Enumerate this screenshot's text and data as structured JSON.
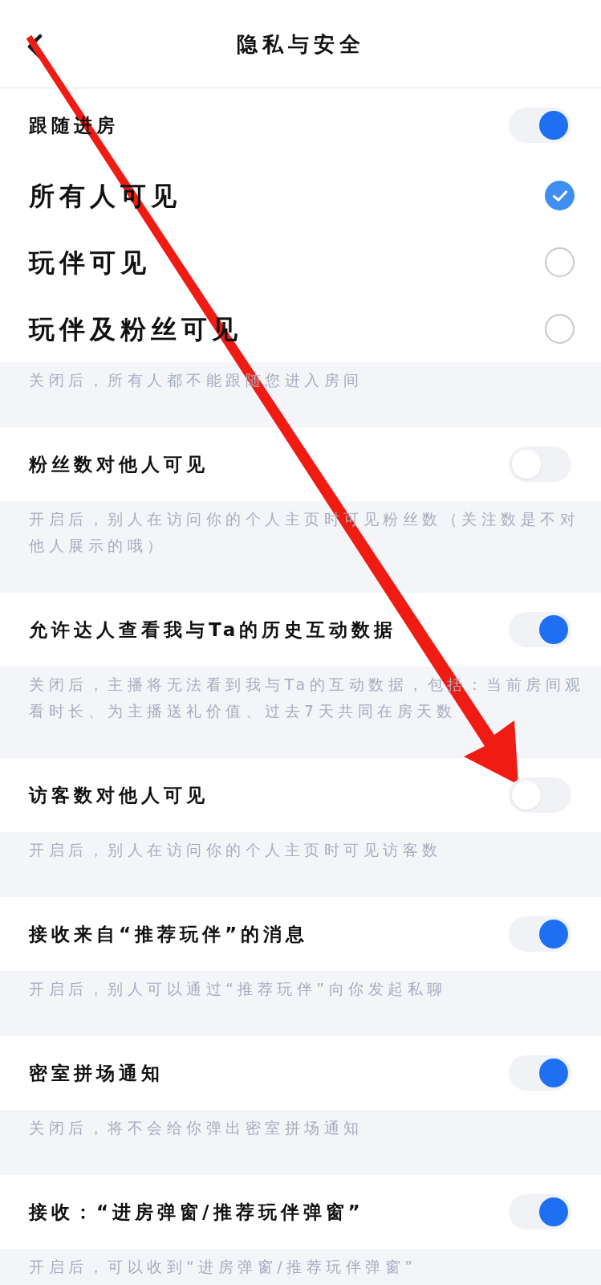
{
  "header": {
    "title": "隐私与安全"
  },
  "settings": [
    {
      "label": "跟随进房",
      "on": true,
      "options": [
        {
          "label": "所有人可见",
          "selected": true
        },
        {
          "label": "玩伴可见",
          "selected": false
        },
        {
          "label": "玩伴及粉丝可见",
          "selected": false
        }
      ],
      "description": "关闭后，所有人都不能跟随您进入房间"
    },
    {
      "label": "粉丝数对他人可见",
      "on": false,
      "description": "开启后，别人在访问你的个人主页时可见粉丝数（关注数是不对他人展示的哦）"
    },
    {
      "label": "允许达人查看我与Ta的历史互动数据",
      "on": true,
      "description": "关闭后，主播将无法看到我与Ta的互动数据，包括：当前房间观看时长、为主播送礼价值、过去7天共同在房天数"
    },
    {
      "label": "访客数对他人可见",
      "on": false,
      "description": "开启后，别人在访问你的个人主页时可见访客数"
    },
    {
      "label": "接收来自“推荐玩伴”的消息",
      "on": true,
      "description": "开启后，别人可以通过“推荐玩伴”向你发起私聊"
    },
    {
      "label": "密室拼场通知",
      "on": true,
      "description": "关闭后，将不会给你弹出密室拼场通知"
    },
    {
      "label": "接收：“进房弹窗/推荐玩伴弹窗”",
      "on": true,
      "description": "开启后，可以收到“进房弹窗/推荐玩伴弹窗”"
    }
  ]
}
